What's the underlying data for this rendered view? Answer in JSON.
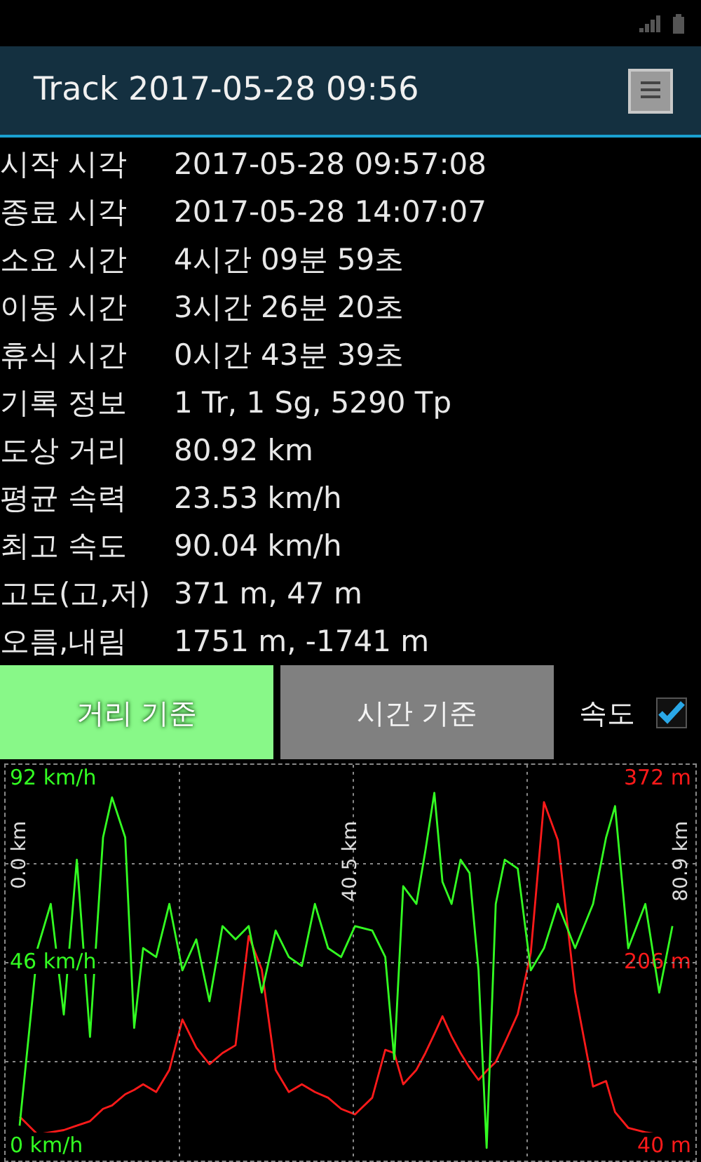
{
  "header": {
    "title": "Track 2017-05-28 09:56"
  },
  "info": [
    {
      "label": "시작 시각",
      "value": "2017-05-28 09:57:08"
    },
    {
      "label": "종료 시각",
      "value": "2017-05-28 14:07:07"
    },
    {
      "label": "소요 시간",
      "value": "4시간 09분 59초"
    },
    {
      "label": "이동 시간",
      "value": "3시간 26분 20초"
    },
    {
      "label": "휴식 시간",
      "value": "0시간 43분 39초"
    },
    {
      "label": "기록 정보",
      "value": "1 Tr, 1 Sg, 5290 Tp"
    },
    {
      "label": "도상 거리",
      "value": "80.92 km"
    },
    {
      "label": "평균 속력",
      "value": "23.53 km/h"
    },
    {
      "label": "최고 속도",
      "value": "90.04 km/h"
    },
    {
      "label": "고도(고,저)",
      "value": "371 m, 47 m"
    },
    {
      "label": "오름,내림",
      "value": "1751 m, -1741 m"
    }
  ],
  "modes": [
    {
      "label": "거리 기준",
      "selected": true
    },
    {
      "label": "시간 기준",
      "selected": false
    }
  ],
  "speed_toggle": {
    "label": "속도",
    "checked": true
  },
  "speed_chart": {
    "chart_data": {
      "type": "line",
      "x": [
        0,
        2.2,
        3.8,
        5.4,
        7.0,
        8.6,
        10.2,
        11.3,
        12.9,
        14.0,
        15.1,
        16.7,
        18.3,
        19.9,
        21.6,
        23.2,
        24.8,
        26.4,
        28.0,
        29.6,
        31.3,
        32.9,
        34.5,
        36.1,
        37.7,
        39.3,
        41.0,
        43.1,
        44.7,
        45.8,
        46.9,
        48.5,
        49.6,
        50.7,
        51.7,
        52.8,
        53.9,
        55.0,
        56.1,
        57.1,
        58.2,
        59.3,
        60.9,
        62.5,
        64.1,
        65.8,
        67.9,
        70.1,
        71.7,
        72.8,
        74.4,
        76.5,
        78.2,
        79.8
      ],
      "xlim": [
        0,
        80.9
      ],
      "xticks": [
        {
          "value": 0,
          "label": "0.0 km"
        },
        {
          "value": 40.5,
          "label": "40.5 km"
        },
        {
          "value": 80.9,
          "label": "80.9 km"
        }
      ],
      "ylim": [
        0,
        92
      ],
      "yticks": [
        {
          "value": 92,
          "label": "92 km/h"
        },
        {
          "value": 46,
          "label": "46 km/h"
        },
        {
          "value": 0,
          "label": "0 km/h"
        }
      ],
      "series": [
        {
          "color": "#33ff22",
          "values": [
            5.5,
            49.6,
            60.6,
            33.1,
            71.6,
            27.6,
            77.1,
            87.1,
            77.1,
            29.8,
            49.6,
            47.4,
            60.6,
            44.1,
            51.8,
            36.4,
            55.1,
            51.8,
            55.1,
            38.6,
            54.0,
            47.4,
            45.2,
            60.6,
            49.6,
            47.4,
            55.1,
            54.0,
            47.4,
            22.0,
            65.0,
            60.6,
            73.8,
            88.2,
            66.1,
            60.6,
            71.6,
            68.3,
            44.1,
            0,
            60.6,
            71.6,
            69.4,
            44.1,
            49.6,
            60.6,
            49.6,
            60.6,
            77.1,
            84.9,
            49.6,
            60.6,
            38.6,
            55.1
          ]
        }
      ]
    }
  },
  "altitude_chart": {
    "chart_data": {
      "type": "line",
      "x": [
        0,
        2.2,
        3.8,
        5.4,
        7.0,
        8.6,
        10.2,
        11.3,
        12.9,
        14.0,
        15.1,
        16.7,
        18.3,
        19.9,
        21.6,
        23.2,
        24.8,
        26.4,
        28.0,
        29.6,
        31.3,
        32.9,
        34.5,
        36.1,
        37.7,
        39.3,
        41.0,
        43.1,
        44.7,
        45.8,
        46.9,
        48.5,
        49.6,
        50.7,
        51.7,
        52.8,
        53.9,
        55.0,
        56.1,
        57.1,
        58.2,
        59.3,
        60.9,
        62.5,
        64.1,
        65.8,
        67.9,
        70.1,
        71.7,
        72.8,
        74.4,
        76.5,
        78.2
      ],
      "xlim": [
        0,
        80.9
      ],
      "ylim": [
        40,
        372
      ],
      "yticks": [
        {
          "value": 372,
          "label": "372 m"
        },
        {
          "value": 206,
          "label": "206 m"
        },
        {
          "value": 40,
          "label": "40 m"
        }
      ],
      "series": [
        {
          "color": "#ff1a1a",
          "values": [
            68,
            52,
            54,
            56,
            60,
            64,
            75,
            78,
            88,
            92,
            97,
            90,
            110,
            155,
            130,
            115,
            125,
            132,
            230,
            200,
            110,
            90,
            97,
            90,
            85,
            75,
            70,
            85,
            128,
            125,
            97,
            110,
            125,
            142,
            158,
            140,
            125,
            112,
            101,
            109,
            117,
            134,
            160,
            215,
            350,
            316,
            180,
            95,
            100,
            72,
            58,
            54,
            52
          ]
        }
      ]
    }
  }
}
